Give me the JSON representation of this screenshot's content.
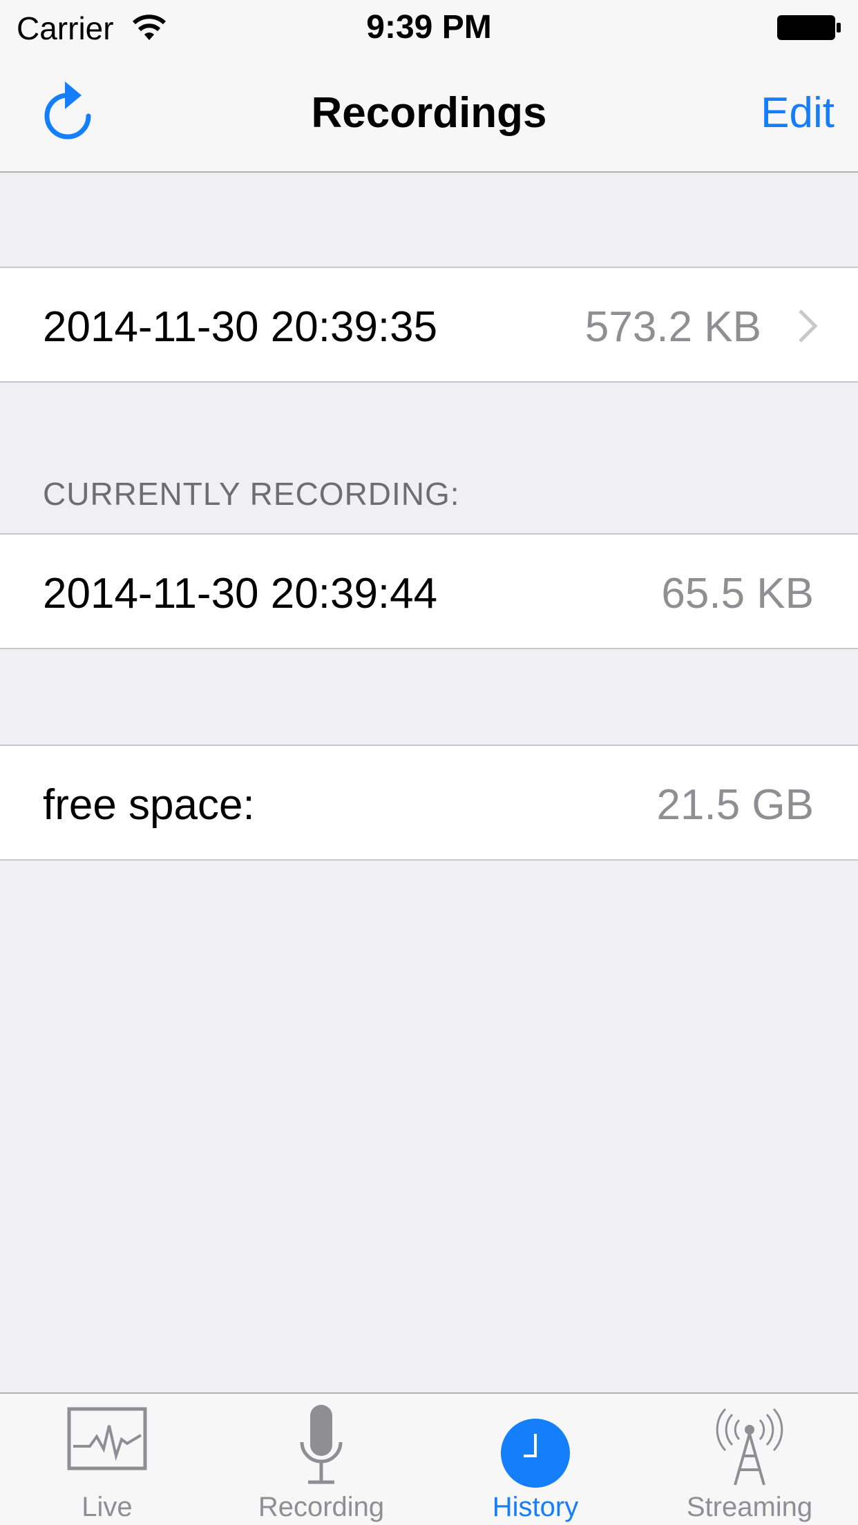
{
  "status_bar": {
    "carrier": "Carrier",
    "time": "9:39 PM"
  },
  "nav_bar": {
    "title": "Recordings",
    "edit_label": "Edit",
    "left_icon": "refresh-icon"
  },
  "recordings": [
    {
      "name": "2014-11-30 20:39:35",
      "size": "573.2 KB",
      "has_disclosure": true
    }
  ],
  "currently_recording": {
    "header": "CURRENTLY RECORDING:",
    "name": "2014-11-30 20:39:44",
    "size": "65.5 KB"
  },
  "storage": {
    "label": "free space:",
    "value": "21.5 GB"
  },
  "tab_bar": {
    "tabs": [
      {
        "label": "Live",
        "icon": "waveform-icon",
        "active": false
      },
      {
        "label": "Recording",
        "icon": "microphone-icon",
        "active": false
      },
      {
        "label": "History",
        "icon": "clock-icon",
        "active": true
      },
      {
        "label": "Streaming",
        "icon": "radio-tower-icon",
        "active": false
      }
    ]
  },
  "colors": {
    "accent": "#147efb",
    "background": "#efeff4",
    "secondary_text": "#8e8e93",
    "section_header": "#6d6d72"
  }
}
